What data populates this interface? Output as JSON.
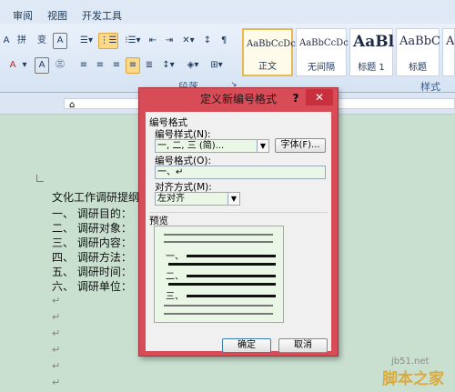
{
  "ribbon": {
    "tabs": [
      "审阅",
      "视图",
      "开发工具"
    ],
    "group_labels": [
      "段落",
      "样式"
    ],
    "styles": [
      {
        "sample": "AaBbCcDc",
        "name": "正文"
      },
      {
        "sample": "AaBbCcDc",
        "name": "无间隔"
      },
      {
        "sample": "AaBl",
        "name": "标题 1"
      },
      {
        "sample": "AaBbC",
        "name": "标题"
      },
      {
        "sample": "Aa",
        "name": ""
      }
    ],
    "colors": {
      "accent": "#fbd988",
      "bg": "#dfe9f5"
    }
  },
  "document": {
    "lines": [
      "文化工作调研提纲↵",
      "一、    调研目的：",
      "二、    调研对象：",
      "三、    调研内容：",
      "四、    调研方法：",
      "五、    调研时间：",
      "六、    调研单位："
    ],
    "empty_marks": [
      "↵",
      "↵",
      "↵",
      "↵",
      "↵",
      "↵",
      "↵",
      "↵"
    ]
  },
  "dialog": {
    "title": "定义新编号格式",
    "help": "?",
    "close": "✕",
    "section_label": "编号格式",
    "style_label": "编号样式(N):",
    "style_value": "一, 二, 三 (简)...",
    "font_button": "字体(F)...",
    "format_label": "编号格式(O):",
    "format_value": "一、↵",
    "align_label": "对齐方式(M):",
    "align_value": "左对齐",
    "preview_label": "预览",
    "preview_numbers": [
      "一、",
      "二、",
      "三、"
    ],
    "ok": "确定",
    "cancel": "取消",
    "colors": {
      "frame": "#d84c57",
      "field": "#eaf6e6"
    }
  },
  "watermark": {
    "text": "脚本之家",
    "url": "jb51.net"
  }
}
